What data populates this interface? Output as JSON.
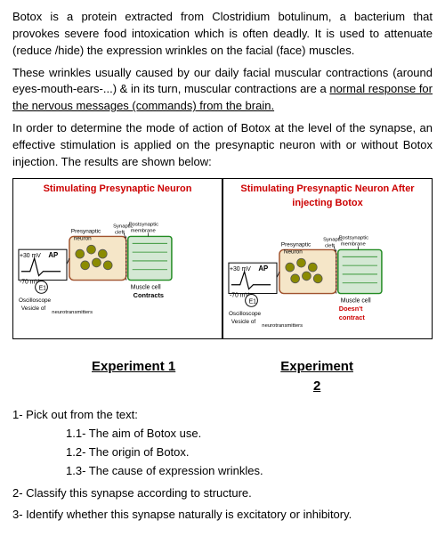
{
  "intro": {
    "para1": "Botox is a protein extracted from Clostridium botulinum, a bacterium that provokes severe food intoxication which is often deadly. It is used to attenuate (reduce /hide) the expression wrinkles on the facial (face) muscles.",
    "para2": "These wrinkles usually caused by our daily facial muscular contractions (around eyes-mouth-ears-...) & in its turn, muscular contractions are a normal response for the nervous messages (commands) from the brain.",
    "para3": "In order to determine the mode of action of Botox at the level of the synapse, an effective stimulation is applied on the presynaptic neuron with or without Botox injection. The results are shown below:"
  },
  "diagram": {
    "left_title": "Stimulating Presynaptic Neuron",
    "right_title": "Stimulating Presynaptic Neuron After injecting Botox",
    "left_labels": {
      "synaptic_cleft": "Synaptic cleft",
      "postsynaptic_membrane": "Postsynaptic membrane",
      "presynaptic_neuron": "Presynaptic neuron",
      "voltage1": "+ 30 mV",
      "ap": "AP",
      "voltage2": "- 70 mV",
      "e1": "E1",
      "oscilloscope": "Oscilloscope",
      "vesicle": "Vesicle of neurotransmitters",
      "muscle_cell": "Muscle cell",
      "contracts": "Contracts"
    },
    "right_labels": {
      "synaptic_cleft": "Synaptic cleft",
      "postsynaptic_membrane": "Postsynaptic membrane",
      "presynaptic_neuron": "Presynaptic Neuron",
      "voltage1": "+ 30 mV",
      "ap": "AP",
      "voltage2": "- 70 mV",
      "e1": "E1",
      "oscilloscope": "Oscilloscope",
      "vesicle": "Vesicle of neurotransmitters",
      "muscle_cell": "Muscle cell",
      "doesnt_contract": "Doesn't contract"
    }
  },
  "experiments": {
    "exp1_label": "Experiment 1",
    "exp2_label": "Experiment",
    "exp2_number": "2"
  },
  "questions": {
    "q1": "1- Pick out from the text:",
    "q1_1": "1.1- The aim of Botox use.",
    "q1_2": "1.2- The origin of Botox.",
    "q1_3": "1.3- The cause of expression wrinkles.",
    "q2": "2- Classify this synapse according to structure.",
    "q3": "3- Identify whether this synapse naturally is excitatory or inhibitory."
  }
}
